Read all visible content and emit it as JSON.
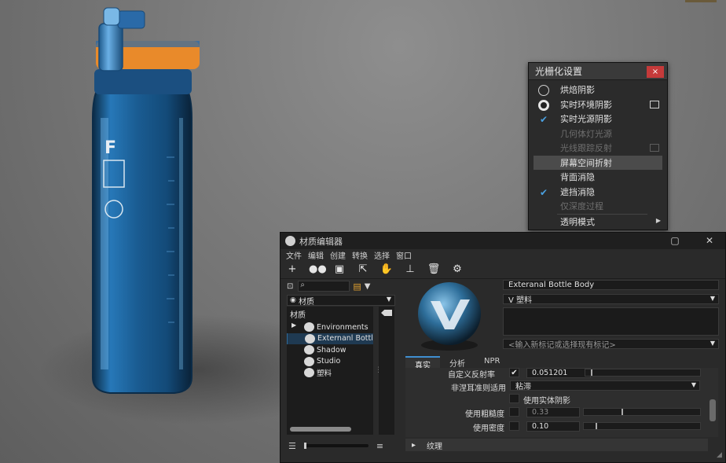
{
  "raster_menu": {
    "title": "光栅化设置",
    "close": "×",
    "items": [
      {
        "label": "烘焙阴影",
        "mark": "radio-empty",
        "disabled": false
      },
      {
        "label": "实时环境阴影",
        "mark": "radio-full",
        "disabled": false,
        "box": true
      },
      {
        "label": "实时光源阴影",
        "mark": "check",
        "disabled": false
      },
      {
        "label": "几何体灯光源",
        "mark": "",
        "disabled": true
      },
      {
        "label": "光线跟踪反射",
        "mark": "",
        "disabled": true,
        "box": true
      },
      {
        "label": "屏幕空间折射",
        "mark": "",
        "disabled": false,
        "highlight": true
      },
      {
        "label": "背面消隐",
        "mark": "",
        "disabled": false
      },
      {
        "label": "遮挡消隐",
        "mark": "check",
        "disabled": false
      },
      {
        "label": "仅深度过程",
        "mark": "",
        "disabled": true
      },
      {
        "label": "透明模式",
        "mark": "",
        "disabled": false,
        "submenu": true
      }
    ]
  },
  "material_editor": {
    "title": "材质编辑器",
    "menu": [
      "文件",
      "编辑",
      "创建",
      "转换",
      "选择",
      "窗口"
    ],
    "library_select": "材质",
    "tree": {
      "header": "材质",
      "items": [
        {
          "label": "Environments",
          "expandable": true,
          "selected": false
        },
        {
          "label": "Externanl Bottl",
          "expandable": false,
          "selected": true
        },
        {
          "label": "Shadow",
          "expandable": false,
          "selected": false
        },
        {
          "label": "Studio",
          "expandable": false,
          "selected": false
        },
        {
          "label": "塑料",
          "expandable": false,
          "selected": false
        }
      ]
    },
    "material_name": "Exteranal Bottle Body",
    "material_type": "V 塑料",
    "tag_placeholder": "<输入新标记或选择现有标记>",
    "tabs": [
      "真实",
      "分析",
      "NPR"
    ],
    "active_tab": "真实",
    "props": {
      "custom_reflect_label": "自定义反射率",
      "custom_reflect_value": "0.051201",
      "custom_reflect_checked": true,
      "custom_reflect_fraction": 0.05,
      "non_fresnel_label": "非涅耳准则适用",
      "non_fresnel_value": "粘滞",
      "use_solid_shadow_label": "使用实体阴影",
      "roughness_label": "使用粗糙度",
      "roughness_value": "0.33",
      "roughness_fraction": 0.33,
      "opacity_label": "使用密度",
      "opacity_value": "0.10",
      "opacity_fraction": 0.1
    },
    "section_texture": "纹理"
  },
  "colors": {
    "accent": "#3f8ed0",
    "bottle_body": "#1d5a8a",
    "bottle_orange": "#e98a2a",
    "close_red": "#c53a3a"
  }
}
